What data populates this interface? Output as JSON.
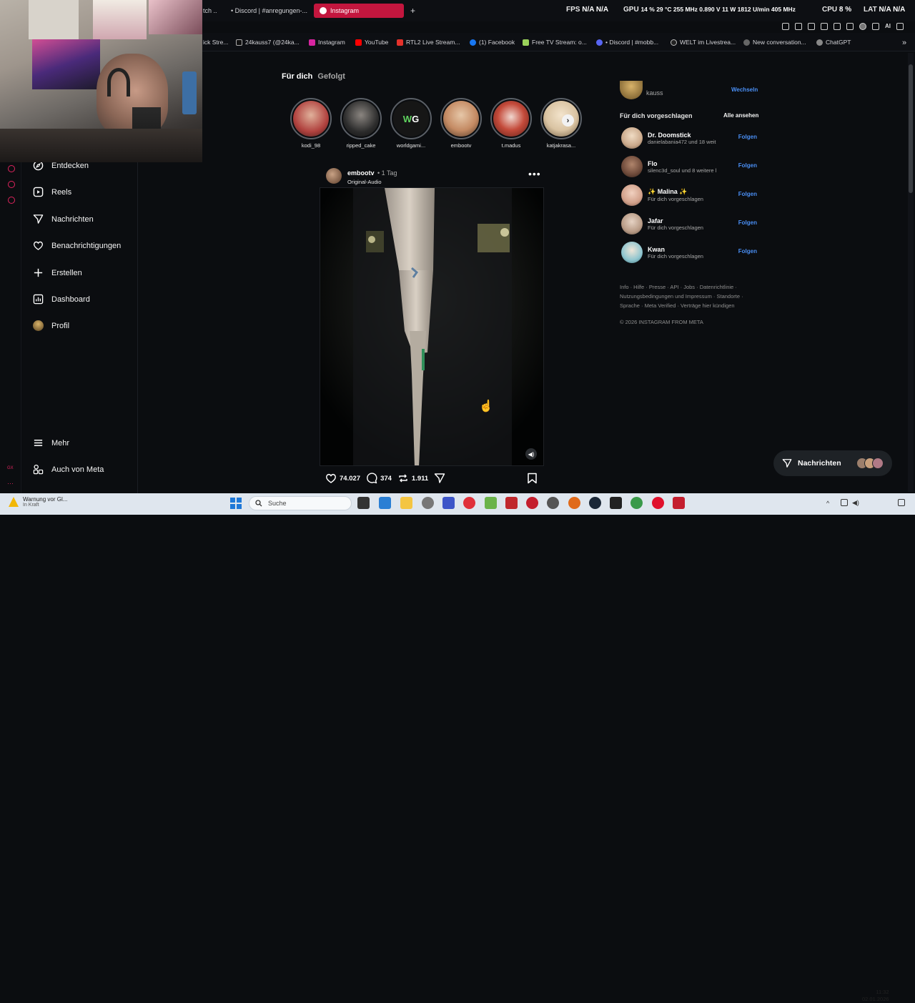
{
  "browser": {
    "tabs": [
      {
        "label": "tch ..."
      },
      {
        "label": "• Discord | #anregungen-..."
      },
      {
        "label": "Instagram",
        "active": true
      }
    ],
    "new_tab": "+",
    "hud": {
      "fps_label": "FPS",
      "fps_val": "N/A N/A",
      "gpu_label": "GPU",
      "gpu_val": "14 % 29 °C 255 MHz 0.890 V 11 W 1812 U/min 405 MHz",
      "cpu_label": "CPU",
      "cpu_val": "8 %",
      "lat_label": "LAT",
      "lat_val": "N/A N/A"
    },
    "toolbar_ai": "AI",
    "bookmarks": [
      {
        "label": "ick Stre...",
        "color": "#8a8a8a"
      },
      {
        "label": "24kauss7 (@24ka...",
        "color": "#111111"
      },
      {
        "label": "Instagram",
        "color": "#d6249f"
      },
      {
        "label": "YouTube",
        "color": "#ff0000"
      },
      {
        "label": "RTL2 Live Stream...",
        "color": "#e4322b"
      },
      {
        "label": "(1) Facebook",
        "color": "#1877f2"
      },
      {
        "label": "Free TV Stream: o...",
        "color": "#9ad15a"
      },
      {
        "label": "• Discord | #mobb...",
        "color": "#5865f2"
      },
      {
        "label": "WELT im Livestrea...",
        "color": "#222222"
      },
      {
        "label": "New conversation...",
        "color": "#666666"
      },
      {
        "label": "ChatGPT",
        "color": "#888888"
      }
    ]
  },
  "sidebar": {
    "items": [
      {
        "label": "Entdecken",
        "icon": "compass-icon"
      },
      {
        "label": "Reels",
        "icon": "reels-icon"
      },
      {
        "label": "Nachrichten",
        "icon": "messages-icon"
      },
      {
        "label": "Benachrichtigungen",
        "icon": "heart-icon"
      },
      {
        "label": "Erstellen",
        "icon": "plus-icon"
      },
      {
        "label": "Dashboard",
        "icon": "dashboard-icon"
      },
      {
        "label": "Profil",
        "icon": "profile-avatar"
      }
    ],
    "more": "Mehr",
    "meta": "Auch von Meta",
    "rail_label": "GX"
  },
  "feed": {
    "tab_for_you": "Für dich",
    "tab_following": "Gefolgt",
    "stories": [
      {
        "name": "kodi_98",
        "color": "#b0413e"
      },
      {
        "name": "ripped_cake",
        "color": "#2c2c2c"
      },
      {
        "name": "worldgami...",
        "color": "#1c1c1c"
      },
      {
        "name": "embootv",
        "color": "#c48a63"
      },
      {
        "name": "t.madus",
        "color": "#c44a3a"
      },
      {
        "name": "katjakrasa...",
        "color": "#d9c3a2"
      }
    ],
    "post": {
      "user": "embootv",
      "time": "• 1 Tag",
      "audio": "Original-Audio",
      "likes": "74.027",
      "comments": "374",
      "reposts": "1.911"
    }
  },
  "right": {
    "account_partial": "kauss",
    "switch": "Wechseln",
    "suggested_title": "Für dich vorgeschlagen",
    "see_all": "Alle ansehen",
    "suggestions": [
      {
        "name": "Dr. Doomstick",
        "sub": "danielabania472 und 18 weit",
        "follow": "Folgen",
        "color": "#caa98b"
      },
      {
        "name": "Flo",
        "sub": "silenc3d_soul und 8 weitere l",
        "follow": "Folgen",
        "color": "#6e4a3a"
      },
      {
        "name": "✨ Malina ✨",
        "sub": "Für dich vorgeschlagen",
        "follow": "Folgen",
        "color": "#d1a08a"
      },
      {
        "name": "Jafar",
        "sub": "Für dich vorgeschlagen",
        "follow": "Folgen",
        "color": "#b89b86"
      },
      {
        "name": "Kwan",
        "sub": "Für dich vorgeschlagen",
        "follow": "Folgen",
        "color": "#8ec5cf"
      }
    ],
    "footer": "Info · Hilfe · Presse · API · Jobs · Datenrichtlinie · Nutzungsbedingungen und Impressum · Standorte · Sprache · Meta Verified · Verträge hier kündigen",
    "copyright": "© 2026 INSTAGRAM FROM META",
    "messages_pill": "Nachrichten"
  },
  "taskbar": {
    "warning_title": "Warnung vor Gl...",
    "warning_sub": "In Kraft",
    "search_placeholder": "Suche",
    "time": "11:32",
    "date": "02.01.2026"
  }
}
